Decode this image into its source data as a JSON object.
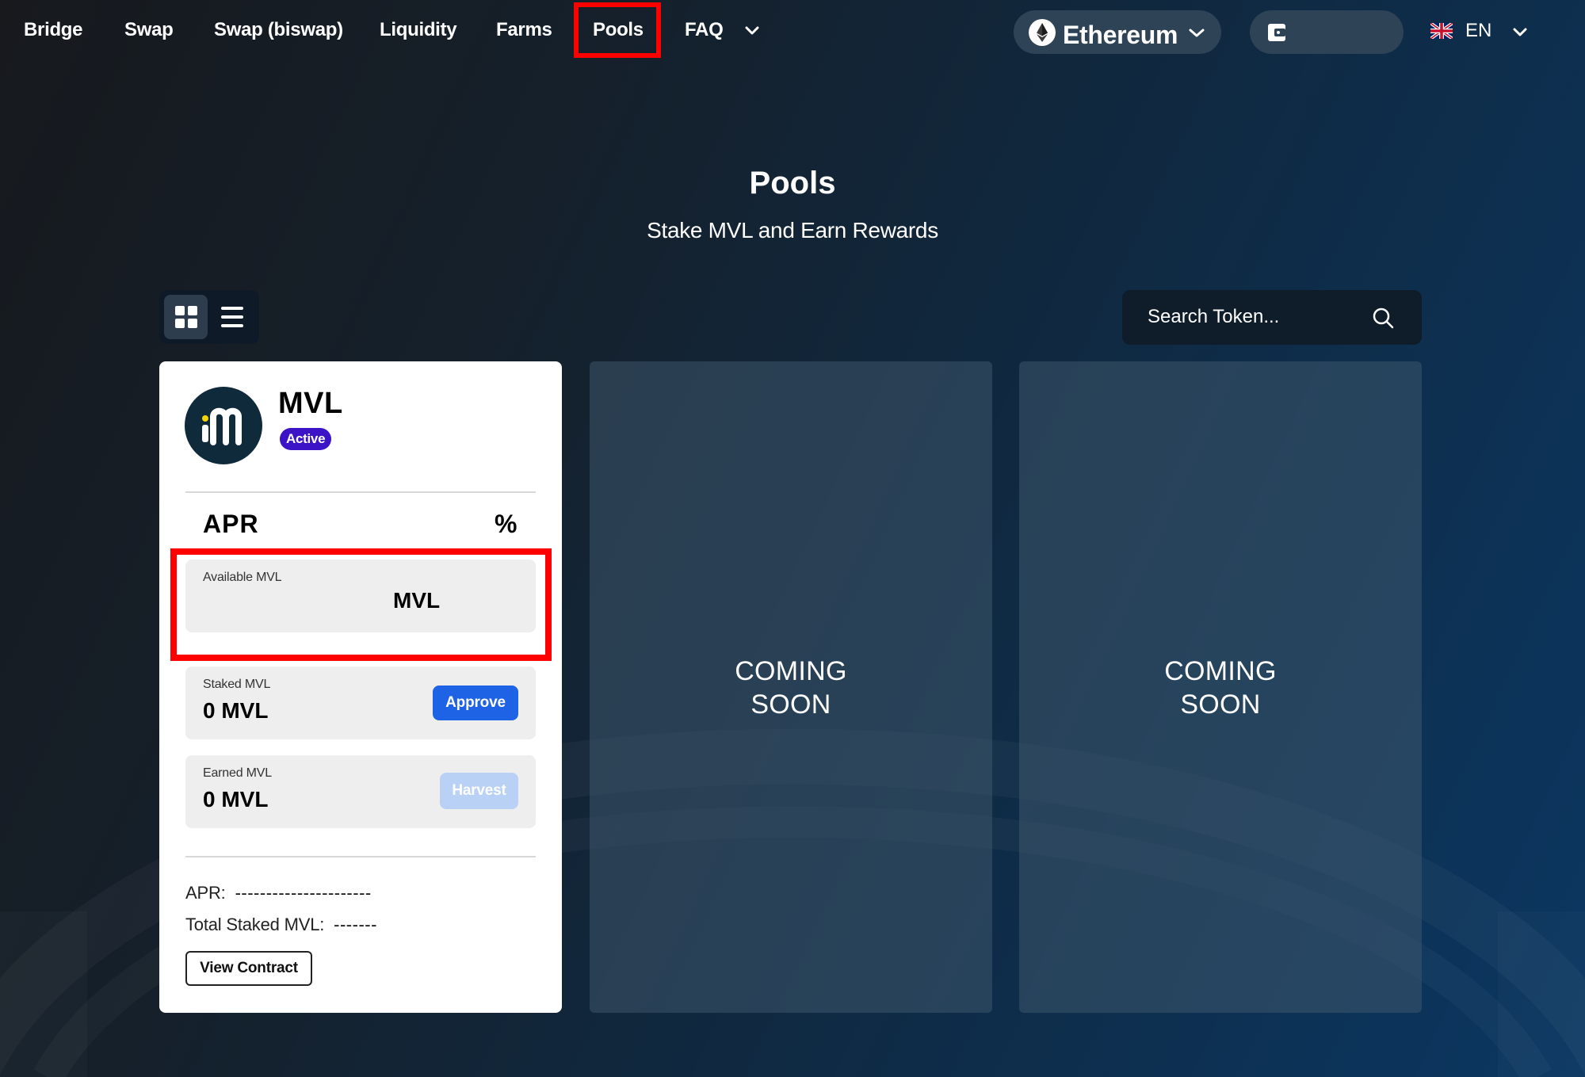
{
  "nav": {
    "items": [
      "Bridge",
      "Swap",
      "Swap (biswap)",
      "Liquidity",
      "Farms",
      "Pools",
      "FAQ"
    ],
    "network_label": "Ethereum",
    "language_label": "EN"
  },
  "header": {
    "title": "Pools",
    "subtitle": "Stake MVL and Earn Rewards"
  },
  "search": {
    "placeholder": "Search Token..."
  },
  "pool": {
    "token_name": "MVL",
    "status": "Active",
    "apr_label": "APR",
    "apr_value": "%",
    "available_label": "Available MVL",
    "available_value": "MVL",
    "staked_label": "Staked MVL",
    "staked_value": "0 MVL",
    "approve_label": "Approve",
    "earned_label": "Earned MVL",
    "earned_value": "0 MVL",
    "harvest_label": "Harvest",
    "apr_stat_label": "APR:",
    "apr_stat_value": "----------------------",
    "total_staked_label": "Total Staked MVL:",
    "total_staked_value": "-------",
    "view_contract_label": "View Contract"
  },
  "coming_soon": {
    "line1": "COMING",
    "line2": "SOON"
  },
  "colors": {
    "accent_blue": "#1e63e6",
    "badge_purple": "#3d13c8",
    "highlight_red": "#ff0000"
  }
}
